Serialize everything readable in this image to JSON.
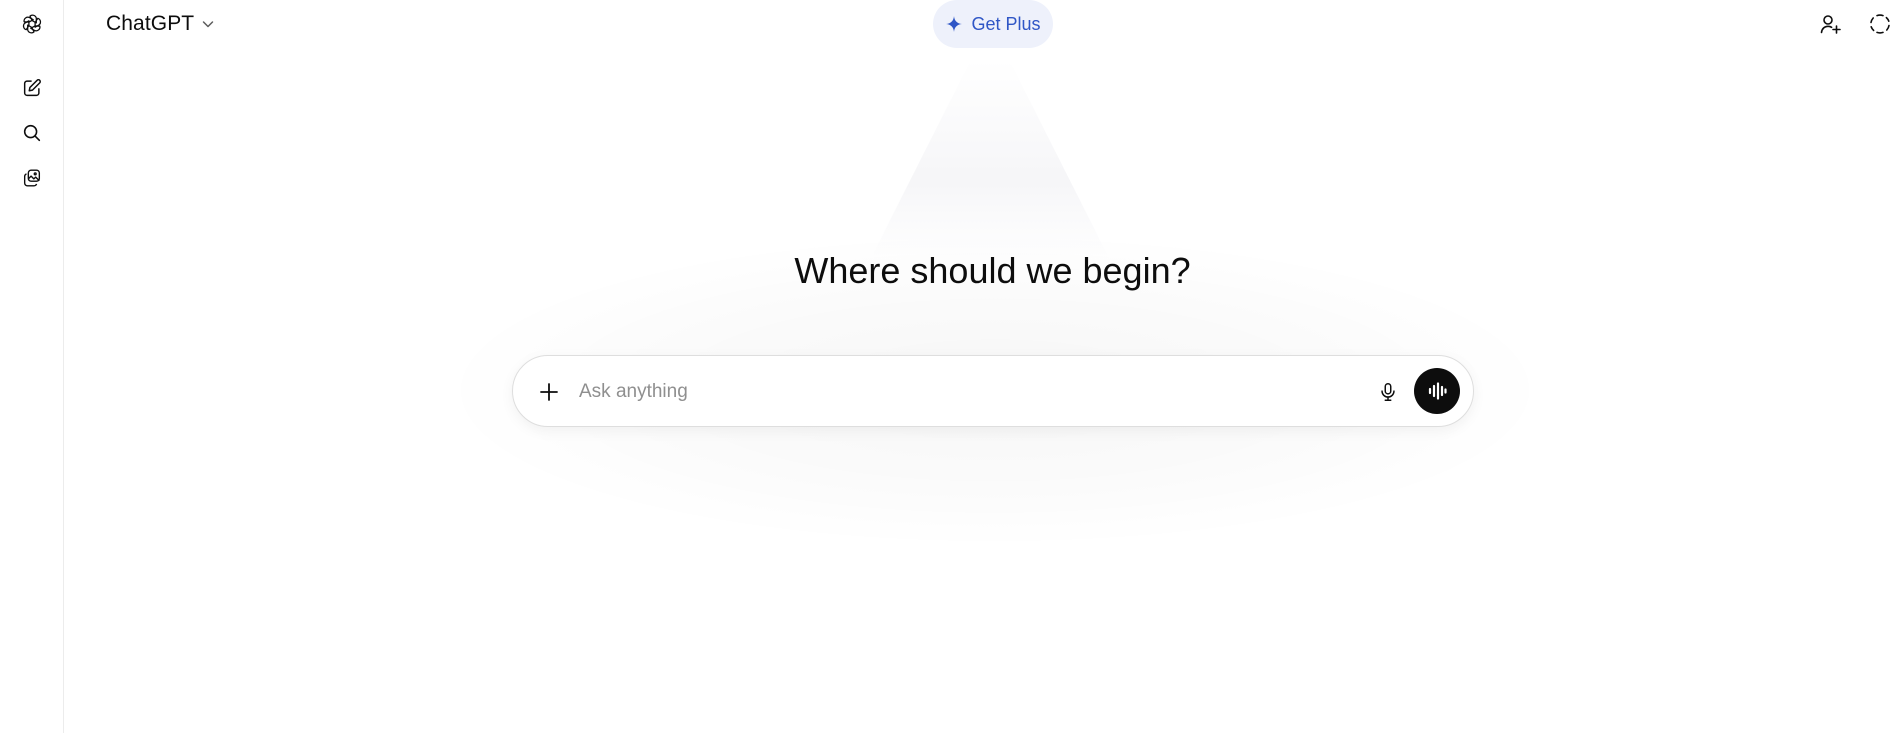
{
  "header": {
    "model_name": "ChatGPT",
    "upgrade_label": "Get Plus"
  },
  "rail": {
    "items": [
      {
        "icon": "openai-logo-icon"
      },
      {
        "icon": "new-chat-icon"
      },
      {
        "icon": "search-icon"
      },
      {
        "icon": "library-icon"
      }
    ]
  },
  "header_actions": [
    {
      "icon": "add-person-icon"
    },
    {
      "icon": "temporary-chat-icon"
    }
  ],
  "main": {
    "headline": "Where should we begin?"
  },
  "composer": {
    "placeholder": "Ask anything",
    "value": ""
  },
  "colors": {
    "accent": "#2f56c6",
    "accent_bg": "#eef1fb",
    "text": "#0d0d0d",
    "placeholder": "#8f8f8f"
  }
}
